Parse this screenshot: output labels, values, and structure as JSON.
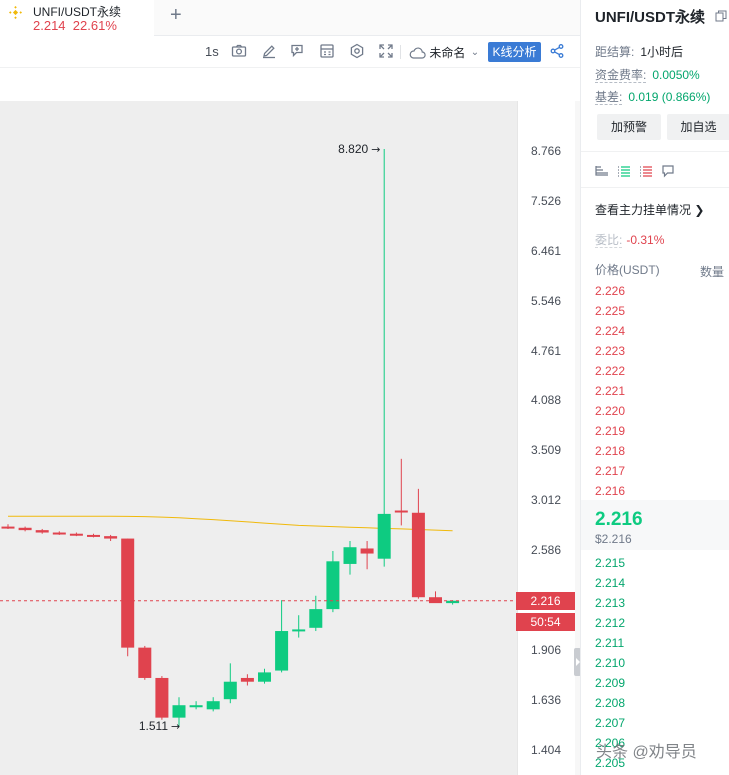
{
  "tab": {
    "symbol": "UNFI/USDT永续",
    "price": "2.214",
    "change": "22.61%",
    "add_label": "+"
  },
  "toolbar": {
    "interval": "1s",
    "layout_label": "未命名",
    "kline_label": "K线分析",
    "icons": [
      "camera-icon",
      "draw-icon",
      "indicator-icon",
      "calculator-icon",
      "gear-icon",
      "fullscreen-icon",
      "cloud-icon",
      "share-icon"
    ]
  },
  "chart": {
    "axis_ticks": [
      "8.766",
      "7.526",
      "6.461",
      "5.546",
      "4.761",
      "4.088",
      "3.509",
      "3.012",
      "2.586",
      "1.906",
      "1.636",
      "1.404"
    ],
    "high_marker": "8.820",
    "low_marker": "1.511",
    "last_price_tag": "2.216",
    "countdown_tag": "50:54",
    "colors": {
      "up": "#0ecb81",
      "down": "#e0434e",
      "ma": "#f0b90b"
    }
  },
  "chart_data": {
    "type": "candlestick",
    "candles": [
      {
        "o": 2.78,
        "h": 2.8,
        "l": 2.76,
        "c": 2.77
      },
      {
        "o": 2.77,
        "h": 2.78,
        "l": 2.74,
        "c": 2.75
      },
      {
        "o": 2.75,
        "h": 2.76,
        "l": 2.72,
        "c": 2.73
      },
      {
        "o": 2.73,
        "h": 2.74,
        "l": 2.71,
        "c": 2.72
      },
      {
        "o": 2.72,
        "h": 2.73,
        "l": 2.7,
        "c": 2.71
      },
      {
        "o": 2.71,
        "h": 2.72,
        "l": 2.69,
        "c": 2.7
      },
      {
        "o": 2.7,
        "h": 2.71,
        "l": 2.66,
        "c": 2.68
      },
      {
        "o": 2.68,
        "h": 2.68,
        "l": 1.87,
        "c": 1.92
      },
      {
        "o": 1.92,
        "h": 1.93,
        "l": 1.74,
        "c": 1.75
      },
      {
        "o": 1.75,
        "h": 1.76,
        "l": 1.54,
        "c": 1.55
      },
      {
        "o": 1.55,
        "h": 1.65,
        "l": 1.511,
        "c": 1.61
      },
      {
        "o": 1.6,
        "h": 1.63,
        "l": 1.59,
        "c": 1.61
      },
      {
        "o": 1.59,
        "h": 1.65,
        "l": 1.58,
        "c": 1.63
      },
      {
        "o": 1.64,
        "h": 1.83,
        "l": 1.62,
        "c": 1.73
      },
      {
        "o": 1.75,
        "h": 1.77,
        "l": 1.71,
        "c": 1.73
      },
      {
        "o": 1.73,
        "h": 1.8,
        "l": 1.72,
        "c": 1.78
      },
      {
        "o": 1.79,
        "h": 2.22,
        "l": 1.78,
        "c": 2.02
      },
      {
        "o": 2.02,
        "h": 2.12,
        "l": 1.98,
        "c": 2.03
      },
      {
        "o": 2.04,
        "h": 2.25,
        "l": 2.02,
        "c": 2.16
      },
      {
        "o": 2.16,
        "h": 2.58,
        "l": 2.14,
        "c": 2.5
      },
      {
        "o": 2.48,
        "h": 2.66,
        "l": 2.4,
        "c": 2.61
      },
      {
        "o": 2.6,
        "h": 2.66,
        "l": 2.44,
        "c": 2.56
      },
      {
        "o": 2.52,
        "h": 8.82,
        "l": 2.46,
        "c": 2.89
      },
      {
        "o": 2.92,
        "h": 3.42,
        "l": 2.79,
        "c": 2.91
      },
      {
        "o": 2.9,
        "h": 3.12,
        "l": 2.23,
        "c": 2.24
      },
      {
        "o": 2.24,
        "h": 2.28,
        "l": 2.21,
        "c": 2.2
      },
      {
        "o": 2.2,
        "h": 2.22,
        "l": 2.19,
        "c": 2.216
      }
    ],
    "ma": [
      2.87,
      2.87,
      2.87,
      2.87,
      2.87,
      2.87,
      2.87,
      2.868,
      2.866,
      2.862,
      2.856,
      2.848,
      2.84,
      2.83,
      2.82,
      2.81,
      2.8,
      2.79,
      2.785,
      2.78,
      2.775,
      2.77,
      2.765,
      2.76,
      2.755,
      2.75,
      2.745
    ],
    "ylim": [
      1.35,
      9.2
    ],
    "scale": "log"
  },
  "right_panel": {
    "title": "UNFI/USDT永续",
    "settlement": {
      "label": "距结算:",
      "value": "1小时后"
    },
    "funding": {
      "label": "资金费率:",
      "value": "0.0050%"
    },
    "basis": {
      "label": "基差:",
      "value": "0.019 (0.866%)"
    },
    "btn_alert": "加预警",
    "btn_fav": "加自选",
    "big_orders": "查看主力挂单情况",
    "ratio": {
      "label": "委比:",
      "value": "-0.31%"
    },
    "col_price": "价格(USDT)",
    "col_qty": "数量",
    "asks": [
      "2.226",
      "2.225",
      "2.224",
      "2.223",
      "2.222",
      "2.221",
      "2.220",
      "2.219",
      "2.218",
      "2.217",
      "2.216"
    ],
    "last": "2.216",
    "last_usd": "$2.216",
    "bids": [
      "2.215",
      "2.214",
      "2.213",
      "2.212",
      "2.211",
      "2.210",
      "2.209",
      "2.208",
      "2.207",
      "2.206",
      "2.205"
    ]
  },
  "watermark": "头条 @劝导员"
}
